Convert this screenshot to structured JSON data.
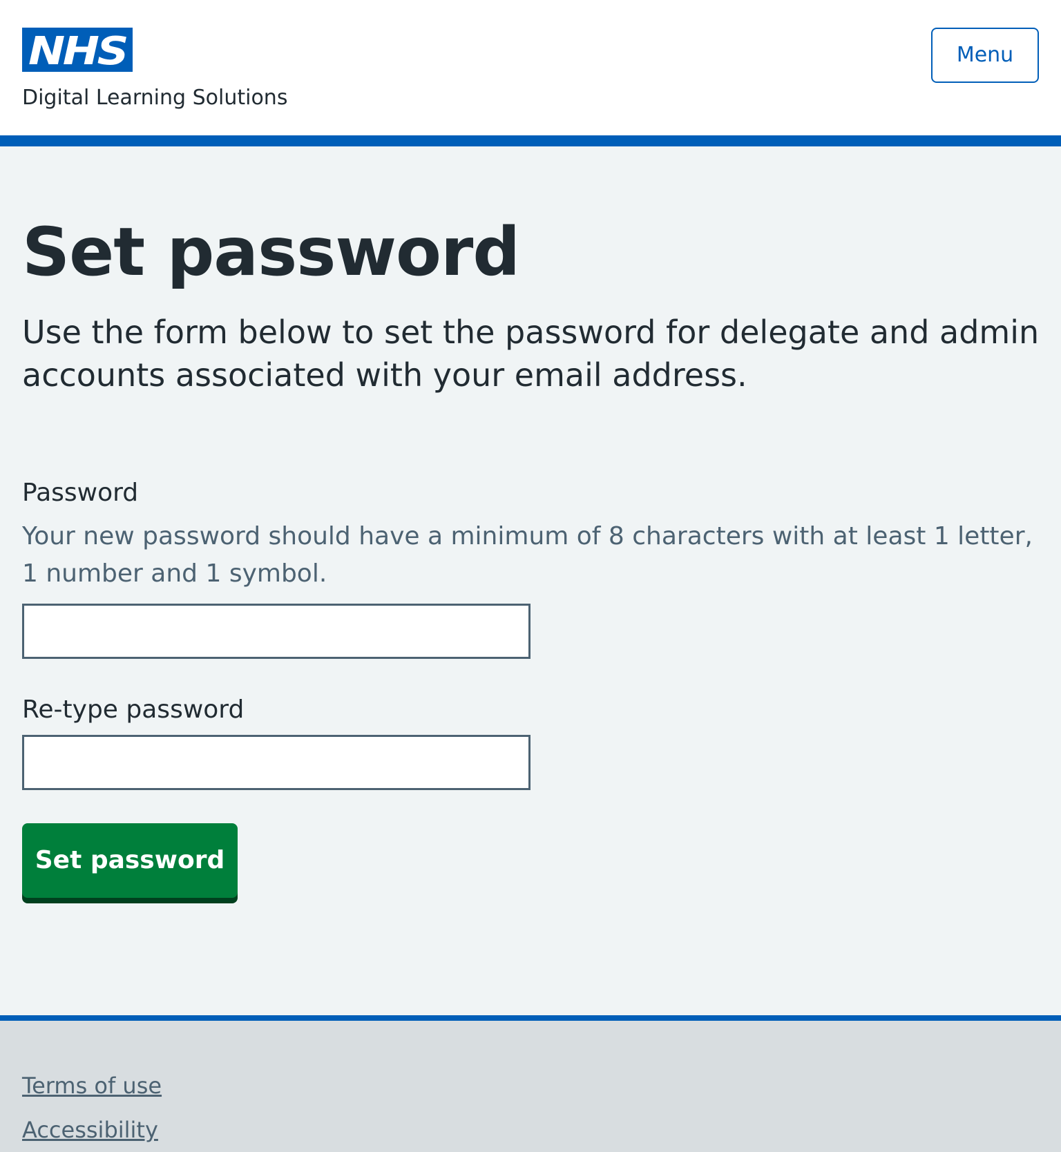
{
  "header": {
    "logo_text": "NHS",
    "service_name": "Digital Learning Solutions",
    "menu_label": "Menu",
    "brand_color": "#005eb8"
  },
  "main": {
    "title": "Set password",
    "lede": "Use the form below to set the password for delegate and admin accounts associated with your email address.",
    "password": {
      "label": "Password",
      "hint": "Your new password should have a minimum of 8 characters with at least 1 letter, 1 number and 1 symbol.",
      "value": ""
    },
    "confirm_password": {
      "label": "Re-type password",
      "value": ""
    },
    "submit_label": "Set password",
    "submit_color": "#007f3b"
  },
  "footer": {
    "links": [
      {
        "label": "Terms of use"
      },
      {
        "label": "Accessibility"
      }
    ]
  }
}
